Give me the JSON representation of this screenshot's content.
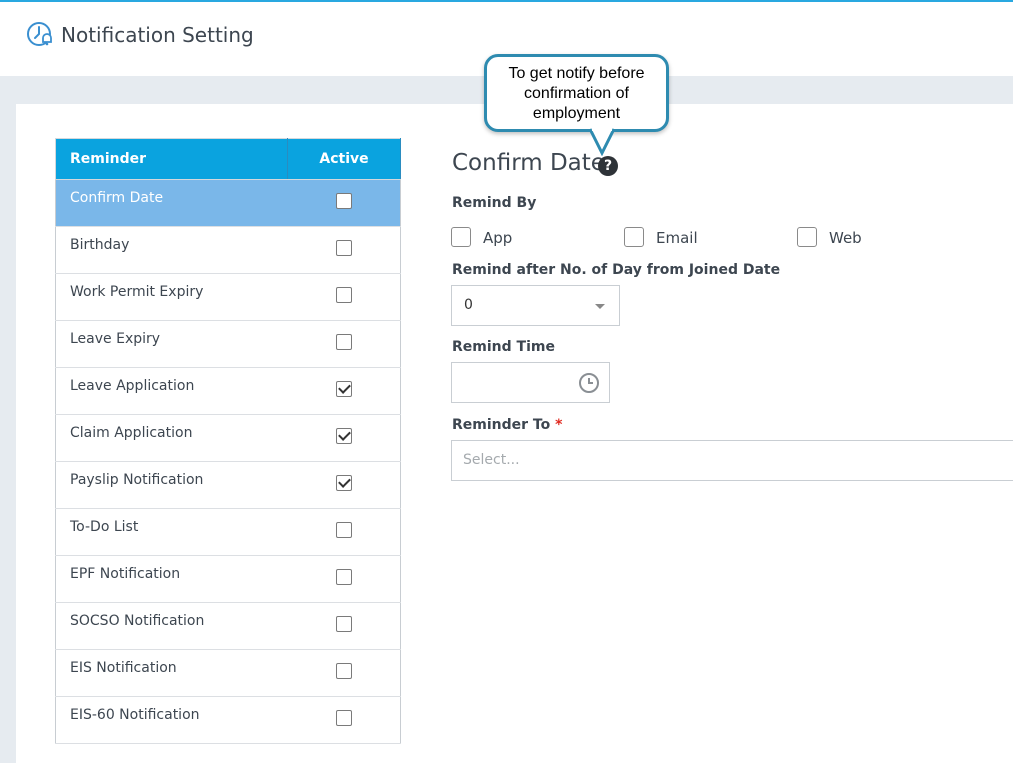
{
  "header": {
    "title": "Notification Setting",
    "icon": "clock-bell-icon"
  },
  "table": {
    "columns": [
      "Reminder",
      "Active"
    ],
    "rows": [
      {
        "label": "Confirm Date",
        "active": false,
        "selected": true
      },
      {
        "label": "Birthday",
        "active": false
      },
      {
        "label": "Work Permit Expiry",
        "active": false
      },
      {
        "label": "Leave Expiry",
        "active": false
      },
      {
        "label": "Leave Application",
        "active": true
      },
      {
        "label": "Claim Application",
        "active": true
      },
      {
        "label": "Payslip Notification",
        "active": true
      },
      {
        "label": "To-Do List",
        "active": false
      },
      {
        "label": "EPF Notification",
        "active": false
      },
      {
        "label": "SOCSO Notification",
        "active": false
      },
      {
        "label": "EIS Notification",
        "active": false
      },
      {
        "label": "EIS-60 Notification",
        "active": false
      }
    ]
  },
  "detail": {
    "title": "Confirm Date",
    "help_icon": "question-circle-icon",
    "remind_by_label": "Remind By",
    "remind_by_options": [
      {
        "label": "App",
        "checked": false
      },
      {
        "label": "Email",
        "checked": false
      },
      {
        "label": "Web",
        "checked": false
      }
    ],
    "remind_after_label": "Remind after No. of Day from Joined Date",
    "remind_after_value": "0",
    "remind_time_label": "Remind Time",
    "remind_time_value": "",
    "reminder_to_label": "Reminder To",
    "required_mark": "*",
    "reminder_to_placeholder": "Select..."
  },
  "callout": {
    "line1": "To get notify before",
    "line2": "confirmation of",
    "line3": "employment"
  },
  "colors": {
    "header_accent": "#0aa3df",
    "selected_row": "#7ab7e9",
    "required": "#e0291f"
  }
}
